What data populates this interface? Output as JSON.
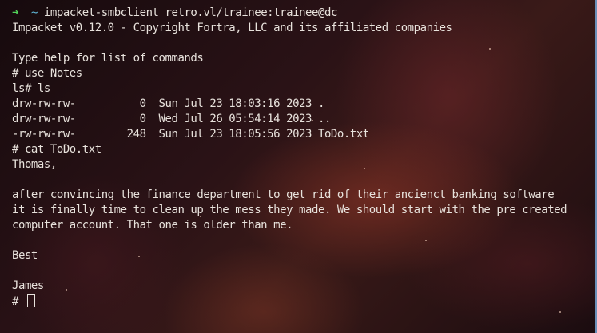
{
  "prompt": {
    "arrow": "➜",
    "tilde": "~",
    "command": "impacket-smbclient retro.vl/trainee:trainee@dc"
  },
  "lines": [
    "Impacket v0.12.0 - Copyright Fortra, LLC and its affiliated companies",
    "",
    "Type help for list of commands",
    "# use Notes",
    "ls# ls",
    "drw-rw-rw-          0  Sun Jul 23 18:03:16 2023 .",
    "drw-rw-rw-          0  Wed Jul 26 05:54:14 2023 ..",
    "-rw-rw-rw-        248  Sun Jul 23 18:05:56 2023 ToDo.txt",
    "# cat ToDo.txt",
    "Thomas,",
    "",
    "after convincing the finance department to get rid of their ancienct banking software",
    "it is finally time to clean up the mess they made. We should start with the pre created",
    "computer account. That one is older than me.",
    "",
    "Best",
    "",
    "James"
  ],
  "final_prompt": "#",
  "colors": {
    "arrow": "#52d35a",
    "tilde": "#61b8d8",
    "text": "#e8e2dc"
  }
}
